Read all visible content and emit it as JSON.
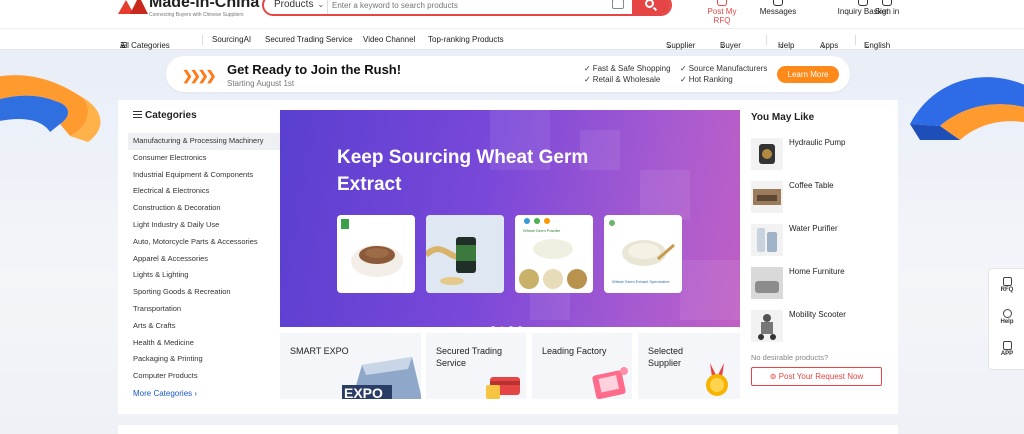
{
  "header": {
    "brand": "Made-in-China",
    "tagline": "Connecting Buyers with Chinese Suppliers",
    "search": {
      "category": "Products",
      "placeholder": "Enter a keyword to search products"
    },
    "actions": [
      {
        "label": "Post My RFQ",
        "icon": "rfq-icon",
        "color": "#e64545"
      },
      {
        "label": "Messages",
        "icon": "message-icon"
      },
      {
        "label": "Inquiry Basket",
        "icon": "basket-icon"
      },
      {
        "label": "Sign in",
        "icon": "user-icon"
      }
    ]
  },
  "nav": {
    "left": [
      "All Categories",
      "SourcingAI",
      "Secured Trading Service",
      "Video Channel",
      "Top-ranking Products"
    ],
    "right": [
      "Supplier",
      "Buyer",
      "Help",
      "Apps",
      "English"
    ]
  },
  "promo": {
    "title": "Get Ready to Join the Rush!",
    "subtitle": "Starting August 1st",
    "features": [
      "Fast & Safe Shopping",
      "Retail & Wholesale",
      "Source Manufacturers",
      "Hot Ranking"
    ],
    "cta": "Learn More",
    "accent": "#ff8a1a"
  },
  "categories": {
    "heading": "Categories",
    "items": [
      "Manufacturing & Processing Machinery",
      "Consumer Electronics",
      "Industrial Equipment & Components",
      "Electrical & Electronics",
      "Construction & Decoration",
      "Light Industry & Daily Use",
      "Auto, Motorcycle Parts & Accessories",
      "Apparel & Accessories",
      "Lights & Lighting",
      "Sporting Goods & Recreation",
      "Transportation",
      "Arts & Crafts",
      "Health & Medicine",
      "Packaging & Printing",
      "Computer Products"
    ],
    "more": "More Categories"
  },
  "banner": {
    "title": "Keep Sourcing Wheat Germ Extract",
    "card3_label": "Wheat Germ Powder",
    "card4_label": "Wheat Germ Extract Spermidine",
    "slides": 4,
    "active_slide": 2
  },
  "tiles": [
    {
      "label": "SMART EXPO",
      "art": "EXPO"
    },
    {
      "label": "Secured Trading Service"
    },
    {
      "label": "Leading Factory"
    },
    {
      "label": "Selected Supplier"
    }
  ],
  "you_may_like": {
    "heading": "You May Like",
    "items": [
      "Hydraulic Pump",
      "Coffee Table",
      "Water Purifier",
      "Home Furniture",
      "Mobility Scooter"
    ],
    "no_products": "No desirable products?",
    "post_request": "Post Your Request Now"
  },
  "side_tools": [
    "RFQ",
    "Help",
    "APP"
  ]
}
